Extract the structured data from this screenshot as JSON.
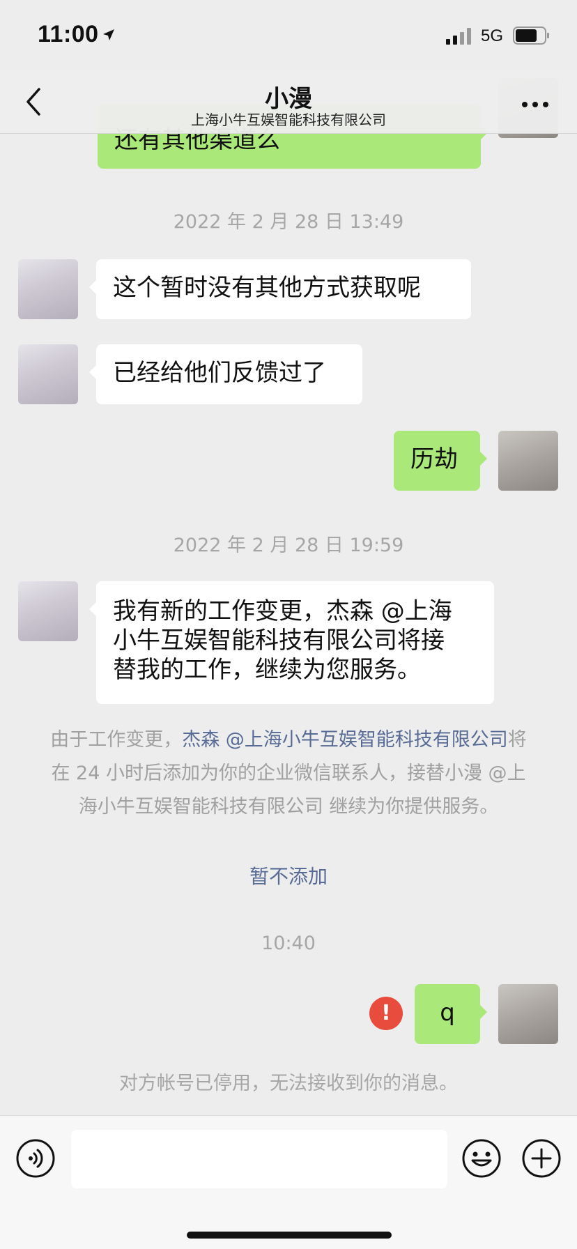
{
  "status": {
    "time": "11:00",
    "network": "5G"
  },
  "nav": {
    "title": "小漫",
    "subtitle": "上海小牛互娱智能科技有限公司"
  },
  "messages": {
    "partial_top": "还有其他渠道么",
    "ts1": "2022 年 2 月 28 日 13:49",
    "m1": "这个暂时没有其他方式获取呢",
    "m2": "已经给他们反馈过了",
    "m3": "历劫",
    "ts2": "2022 年 2 月 28 日 19:59",
    "m4_lines": [
      "我有新的工作变更，杰森 @上海",
      "小牛互娱智能科技有限公司将接",
      "替我的工作，继续为您服务。"
    ],
    "ts3": "10:40",
    "m5": "q"
  },
  "system": {
    "notice_prefix": "由于工作变更，",
    "notice_link": "杰森 @上海小牛互娱智能科技有限公司",
    "notice_suffix": "将在 24 小时后添加为你的企业微信联系人，接替小漫 @上海小牛互娱智能科技有限公司 继续为你提供服务。",
    "action": "暂不添加",
    "disabled": "对方帐号已停用，无法接收到你的消息。",
    "error_mark": "!"
  },
  "colors": {
    "sent_bubble": "#a9e879",
    "link": "#576b95",
    "error": "#e84c3d"
  }
}
